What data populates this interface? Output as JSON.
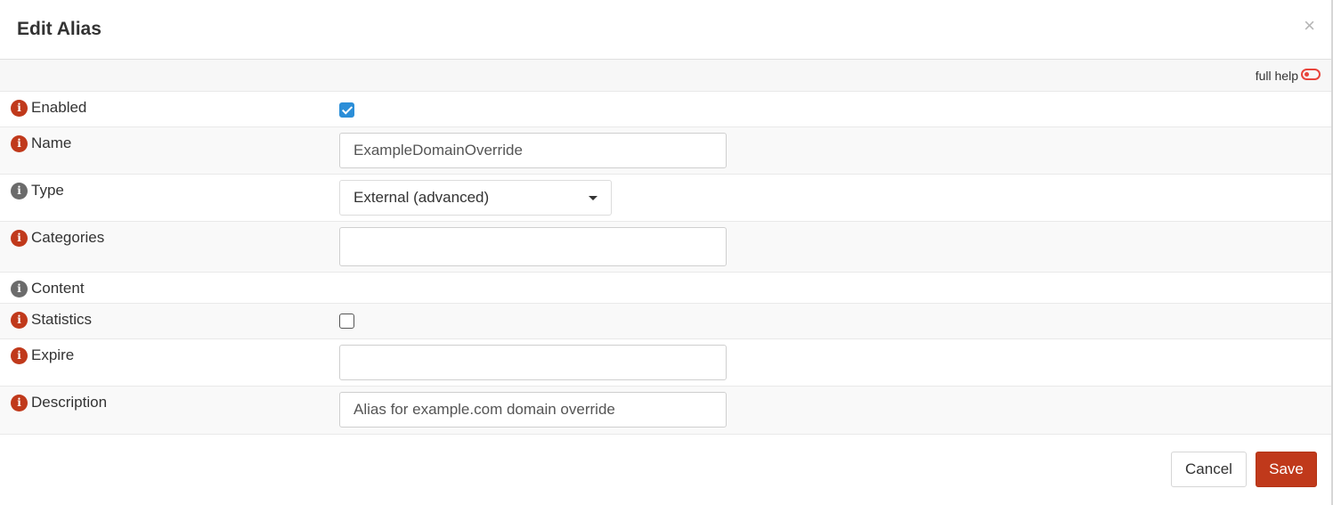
{
  "dialog": {
    "title": "Edit Alias",
    "close_glyph": "×",
    "full_help_label": "full help",
    "info_glyph": "i"
  },
  "fields": {
    "enabled": {
      "label": "Enabled",
      "checked": true
    },
    "name": {
      "label": "Name",
      "value": "ExampleDomainOverride"
    },
    "type": {
      "label": "Type",
      "value": "External (advanced)"
    },
    "categories": {
      "label": "Categories",
      "value": ""
    },
    "content": {
      "label": "Content"
    },
    "statistics": {
      "label": "Statistics",
      "checked": false
    },
    "expire": {
      "label": "Expire",
      "value": ""
    },
    "description": {
      "label": "Description",
      "value": "Alias for example.com domain override"
    }
  },
  "footer": {
    "cancel_label": "Cancel",
    "save_label": "Save"
  },
  "colors": {
    "accent": "#c0391b",
    "checkbox": "#2b8ed8",
    "toggle": "#e8443b",
    "info_gray": "#6b6b6b"
  },
  "icons": [
    "info-icon",
    "close-icon",
    "toggle-off-icon",
    "chevron-down-icon",
    "check-icon"
  ]
}
